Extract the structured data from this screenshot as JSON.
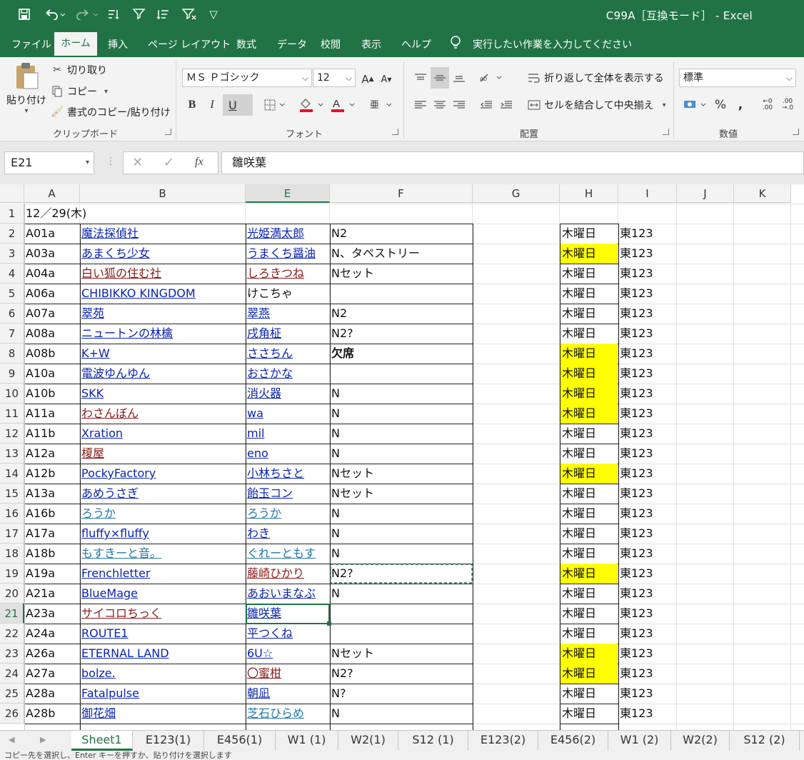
{
  "window": {
    "title": "C99A［互換モード］ - Excel"
  },
  "qat": {
    "more": "▽"
  },
  "menu": {
    "tabs": [
      "ファイル",
      "ホーム",
      "挿入",
      "ページ レイアウト",
      "数式",
      "データ",
      "校閲",
      "表示",
      "ヘルプ"
    ],
    "tell_me": "実行したい作業を入力してください"
  },
  "ribbon": {
    "clipboard": {
      "paste": "貼り付け",
      "cut": "切り取り",
      "copy": "コピー",
      "format_painter": "書式のコピー/貼り付け",
      "label": "クリップボード"
    },
    "font": {
      "name": "ＭＳ Ｐゴシック",
      "size": "12",
      "bold": "B",
      "italic": "I",
      "underline": "U",
      "label": "フォント"
    },
    "alignment": {
      "wrap": "折り返して全体を表示する",
      "merge": "セルを結合して中央揃え",
      "label": "配置"
    },
    "number": {
      "format": "標準",
      "percent": "%",
      "comma": ",",
      "label": "数値"
    }
  },
  "formula_bar": {
    "name_box": "E21",
    "fx": "fx",
    "content": "雛咲葉"
  },
  "columns": [
    "A",
    "B",
    "E",
    "F",
    "G",
    "H",
    "I",
    "J",
    "K"
  ],
  "row1": {
    "num": "1",
    "text": "12／29(木)"
  },
  "rows": [
    {
      "n": "2",
      "a": "A01a",
      "b": "魔法探偵社",
      "e": "光姫満太郎",
      "f": "N2",
      "h": "木曜日",
      "i": "東123"
    },
    {
      "n": "3",
      "a": "A03a",
      "b": "あまくち少女",
      "e": "うまくち醤油",
      "f": "N、タペストリー",
      "h": "木曜日",
      "i": "東123"
    },
    {
      "n": "4",
      "a": "A04a",
      "b": "白い狐の住む社",
      "e": "しろきつね",
      "f": "Nセット",
      "h": "木曜日",
      "i": "東123"
    },
    {
      "n": "5",
      "a": "A06a",
      "b": "CHIBIKKO KINGDOM",
      "e": "けこちゃ",
      "f": "",
      "h": "木曜日",
      "i": "東123"
    },
    {
      "n": "6",
      "a": "A07a",
      "b": "翠苑",
      "e": "翠燕",
      "f": "N2",
      "h": "木曜日",
      "i": "東123"
    },
    {
      "n": "7",
      "a": "A08a",
      "b": "ニュートンの林檎",
      "e": "戌角柾",
      "f": "N2?",
      "h": "木曜日",
      "i": "東123"
    },
    {
      "n": "8",
      "a": "A08b",
      "b": "K+W",
      "e": "ささちん",
      "f": "欠席",
      "h": "木曜日",
      "i": "東123"
    },
    {
      "n": "9",
      "a": "A10a",
      "b": "電波ゆんゆん",
      "e": "おさかな",
      "f": "",
      "h": "木曜日",
      "i": "東123"
    },
    {
      "n": "10",
      "a": "A10b",
      "b": "SKK",
      "e": "消火器",
      "f": "N",
      "h": "木曜日",
      "i": "東123"
    },
    {
      "n": "11",
      "a": "A11a",
      "b": "わさんぼん",
      "e": "wa",
      "f": "N",
      "h": "木曜日",
      "i": "東123"
    },
    {
      "n": "12",
      "a": "A11b",
      "b": "Xration",
      "e": "mil",
      "f": "N",
      "h": "木曜日",
      "i": "東123"
    },
    {
      "n": "13",
      "a": "A12a",
      "b": "榎屋",
      "e": "eno",
      "f": "N",
      "h": "木曜日",
      "i": "東123"
    },
    {
      "n": "14",
      "a": "A12b",
      "b": "PockyFactory",
      "e": "小林ちさと",
      "f": "Nセット",
      "h": "木曜日",
      "i": "東123"
    },
    {
      "n": "15",
      "a": "A13a",
      "b": "あめうさぎ",
      "e": "飴玉コン",
      "f": "Nセット",
      "h": "木曜日",
      "i": "東123"
    },
    {
      "n": "16",
      "a": "A16b",
      "b": "ろうか",
      "e": "ろうか",
      "f": "N",
      "h": "木曜日",
      "i": "東123"
    },
    {
      "n": "17",
      "a": "A17a",
      "b": "fluffy×fluffy",
      "e": "わき",
      "f": "N",
      "h": "木曜日",
      "i": "東123"
    },
    {
      "n": "18",
      "a": "A18b",
      "b": "もすきーと音。",
      "e": "ぐれーともす",
      "f": "N",
      "h": "木曜日",
      "i": "東123"
    },
    {
      "n": "19",
      "a": "A19a",
      "b": "Frenchletter",
      "e": "藤崎ひかり",
      "f": "N2?",
      "h": "木曜日",
      "i": "東123"
    },
    {
      "n": "20",
      "a": "A21a",
      "b": "BlueMage",
      "e": "あおいまなぶ",
      "f": "N",
      "h": "木曜日",
      "i": "東123"
    },
    {
      "n": "21",
      "a": "A23a",
      "b": "サイコロちっく",
      "e": "雛咲葉",
      "f": "",
      "h": "木曜日",
      "i": "東123"
    },
    {
      "n": "22",
      "a": "A24a",
      "b": "ROUTE1",
      "e": "平つくね",
      "f": "",
      "h": "木曜日",
      "i": "東123"
    },
    {
      "n": "23",
      "a": "A26a",
      "b": "ETERNAL LAND",
      "e": "6U☆",
      "f": "Nセット",
      "h": "木曜日",
      "i": "東123"
    },
    {
      "n": "24",
      "a": "A27a",
      "b": "bolze.",
      "e": "〇蜜柑",
      "f": "N2?",
      "h": "木曜日",
      "i": "東123"
    },
    {
      "n": "25",
      "a": "A28a",
      "b": "Fatalpulse",
      "e": "朝凪",
      "f": "N?",
      "h": "木曜日",
      "i": "東123"
    },
    {
      "n": "26",
      "a": "A28b",
      "b": "御花畑",
      "e": "芝石ひらめ",
      "f": "N",
      "h": "木曜日",
      "i": "東123"
    }
  ],
  "highlight_color": "#ffff00",
  "accent_color": "#217346",
  "sheet_tabs": [
    "Sheet1",
    "E123(1)",
    "E456(1)",
    "W1 (1)",
    "W2(1)",
    "S12 (1)",
    "E123(2)",
    "E456(2)",
    "W1 (2)",
    "W2(2)",
    "S12 (2)"
  ],
  "status": "コピー先を選択し、Enter キーを押すか、貼り付けを選択します"
}
